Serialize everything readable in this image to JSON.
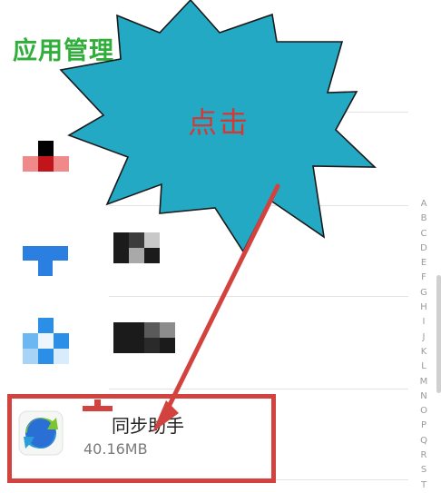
{
  "header": {
    "title": "应用管理"
  },
  "callout": {
    "text": "点击"
  },
  "highlighted_app": {
    "name": "同步助手",
    "size": "40.16MB"
  },
  "alphabet_index": [
    "A",
    "B",
    "C",
    "D",
    "E",
    "F",
    "G",
    "H",
    "I",
    "J",
    "K",
    "L",
    "M",
    "N",
    "O",
    "P",
    "Q",
    "R",
    "S",
    "T"
  ],
  "colors": {
    "title": "#2fae3a",
    "callout_fill": "#23a9c4",
    "annotation_red": "#d2423f",
    "index_letter": "#9a9a9a"
  },
  "icons": {
    "app1": "pixelated-red-app-icon",
    "app2": "pixelated-blue-t-app-icon",
    "app3": "pixelated-blue-app-icon",
    "app4": "sync-assistant-icon"
  }
}
